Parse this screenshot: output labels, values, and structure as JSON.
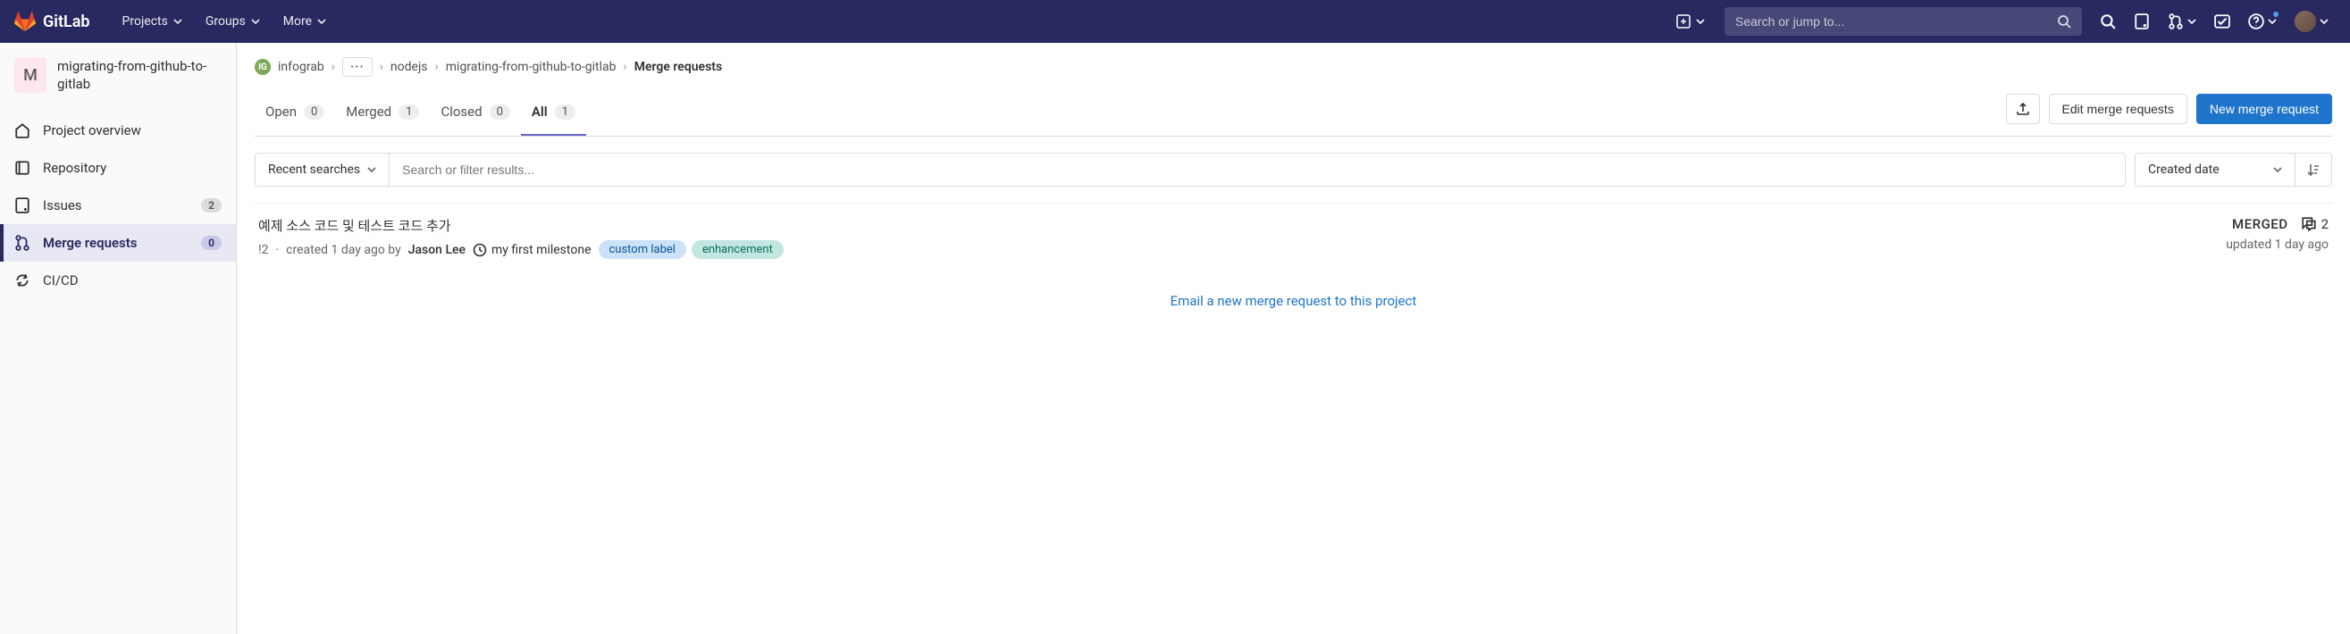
{
  "topbar": {
    "brand": "GitLab",
    "nav": {
      "projects": "Projects",
      "groups": "Groups",
      "more": "More"
    },
    "search_placeholder": "Search or jump to..."
  },
  "sidebar": {
    "project_initial": "M",
    "project_name": "migrating-from-github-to-gitlab",
    "items": [
      {
        "label": "Project overview",
        "badge": null
      },
      {
        "label": "Repository",
        "badge": null
      },
      {
        "label": "Issues",
        "badge": "2"
      },
      {
        "label": "Merge requests",
        "badge": "0"
      },
      {
        "label": "CI/CD",
        "badge": null
      }
    ]
  },
  "breadcrumb": {
    "group_initial": "IG",
    "group": "infograb",
    "subgroup": "nodejs",
    "project": "migrating-from-github-to-gitlab",
    "current": "Merge requests"
  },
  "tabs": {
    "open": {
      "label": "Open",
      "count": "0"
    },
    "merged": {
      "label": "Merged",
      "count": "1"
    },
    "closed": {
      "label": "Closed",
      "count": "0"
    },
    "all": {
      "label": "All",
      "count": "1"
    }
  },
  "actions": {
    "edit": "Edit merge requests",
    "new": "New merge request"
  },
  "filter": {
    "recent": "Recent searches",
    "placeholder": "Search or filter results...",
    "sort": "Created date"
  },
  "mr": {
    "title": "예제 소스 코드 및 테스트 코드 추가",
    "ref": "!2",
    "created": "created 1 day ago by",
    "author": "Jason Lee",
    "milestone": "my first milestone",
    "labels": [
      {
        "text": "custom label",
        "bg": "#cbe2f9",
        "fg": "#0b5394"
      },
      {
        "text": "enhancement",
        "bg": "#c3e6e1",
        "fg": "#0a6e5f"
      }
    ],
    "status": "MERGED",
    "comments": "2",
    "updated": "updated 1 day ago"
  },
  "email_link": "Email a new merge request to this project"
}
